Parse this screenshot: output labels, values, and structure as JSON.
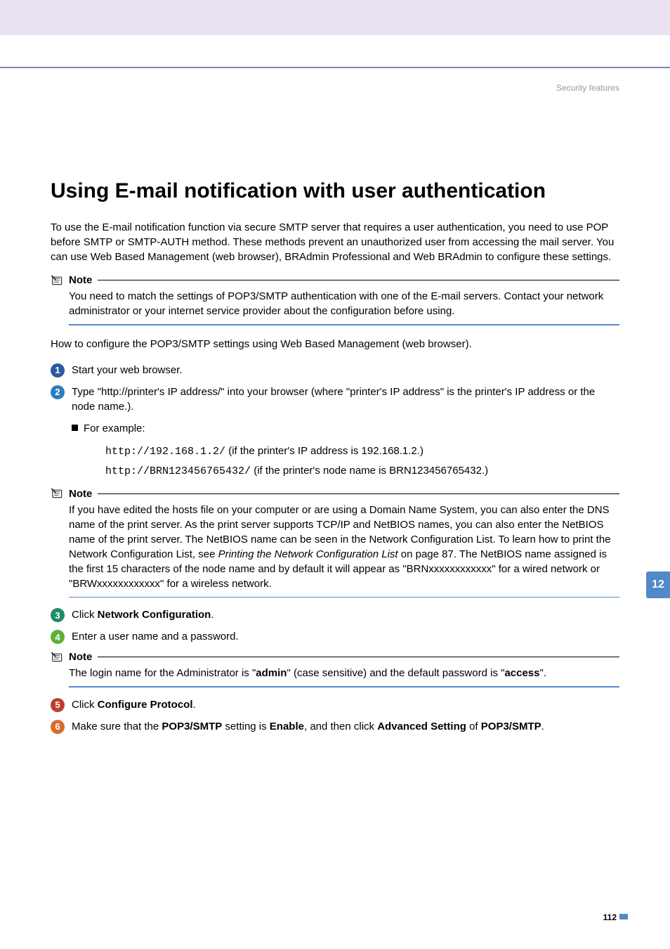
{
  "breadcrumb": "Security features",
  "heading": "Using E-mail notification with user authentication",
  "intro": "To use the E-mail notification function via secure SMTP server that requires a user authentication, you need to use POP before SMTP or SMTP-AUTH method. These methods prevent an unauthorized user from accessing the mail server. You can use Web Based Management (web browser), BRAdmin Professional and Web BRAdmin to configure these settings.",
  "notes": {
    "label": "Note",
    "n1": "You need to match the settings of POP3/SMTP authentication with one of the E-mail servers. Contact your network administrator or your internet service provider about the configuration before using.",
    "n2_a": "If you have edited the hosts file on your computer or are using a Domain Name System, you can also enter the DNS name of the print server. As the print server supports TCP/IP and NetBIOS names, you can also enter the NetBIOS name of the print server. The NetBIOS name can be seen in the Network Configuration List. To learn how to print the Network Configuration List, see ",
    "n2_italic": "Printing the Network Configuration List",
    "n2_b": " on page 87. The NetBIOS name assigned is the first 15 characters of the node name and by default it will appear as \"BRNxxxxxxxxxxxx\" for a wired network or \"BRWxxxxxxxxxxxx\" for a wireless network.",
    "n3_a": "The login name for the Administrator is \"",
    "n3_b1": "admin",
    "n3_c": "\" (case sensitive) and the default password is \"",
    "n3_b2": "access",
    "n3_d": "\"."
  },
  "howto": "How to configure the POP3/SMTP settings using Web Based Management (web browser).",
  "steps": {
    "s1": "Start your web browser.",
    "s2": "Type \"http://printer's IP address/\" into your browser (where \"printer's IP address\" is the printer's IP address or the node name.).",
    "example_label": "For example:",
    "ex1_code": "http://192.168.1.2/",
    "ex1_desc": "  (if the printer's IP address is 192.168.1.2.)",
    "ex2_code": "http://BRN123456765432/",
    "ex2_desc": "  (if the printer's node name is BRN123456765432.)",
    "s3_a": "Click ",
    "s3_b": "Network Configuration",
    "s3_c": ".",
    "s4": "Enter a user name and a password.",
    "s5_a": "Click ",
    "s5_b": "Configure Protocol",
    "s5_c": ".",
    "s6_a": "Make sure that the ",
    "s6_b": "POP3/SMTP",
    "s6_c": " setting is ",
    "s6_d": "Enable",
    "s6_e": ", and then click ",
    "s6_f": "Advanced Setting",
    "s6_g": " of ",
    "s6_h": "POP3/SMTP",
    "s6_i": "."
  },
  "sideTab": "12",
  "pageNum": "112"
}
